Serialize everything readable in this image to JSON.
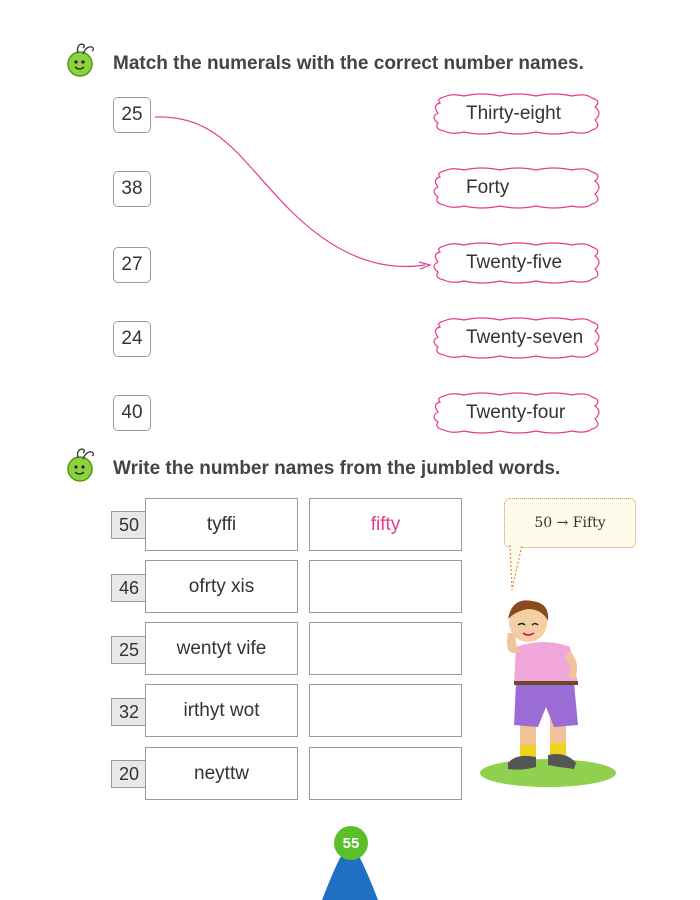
{
  "section1": {
    "heading": "Match the numerals with the correct number names.",
    "numerals": [
      "25",
      "38",
      "27",
      "24",
      "40"
    ],
    "names": [
      "Thirty-eight",
      "Forty",
      "Twenty-five",
      "Twenty-seven",
      "Twenty-four"
    ],
    "example_match": {
      "from": "25",
      "to": "Twenty-five"
    }
  },
  "section2": {
    "heading": "Write the number names from the jumbled words.",
    "rows": [
      {
        "number": "50",
        "jumbled": "tyffi",
        "answer": "fifty"
      },
      {
        "number": "46",
        "jumbled": "ofrty xis",
        "answer": ""
      },
      {
        "number": "25",
        "jumbled": "wentyt vife",
        "answer": ""
      },
      {
        "number": "32",
        "jumbled": "irthyt wot",
        "answer": ""
      },
      {
        "number": "20",
        "jumbled": "neyttw",
        "answer": ""
      }
    ],
    "hint": "50 → Fifty"
  },
  "footer": {
    "page_number": "55"
  },
  "colors": {
    "accent_pink": "#e6398f",
    "green": "#5bbf2a",
    "blue": "#1f6fc4"
  }
}
